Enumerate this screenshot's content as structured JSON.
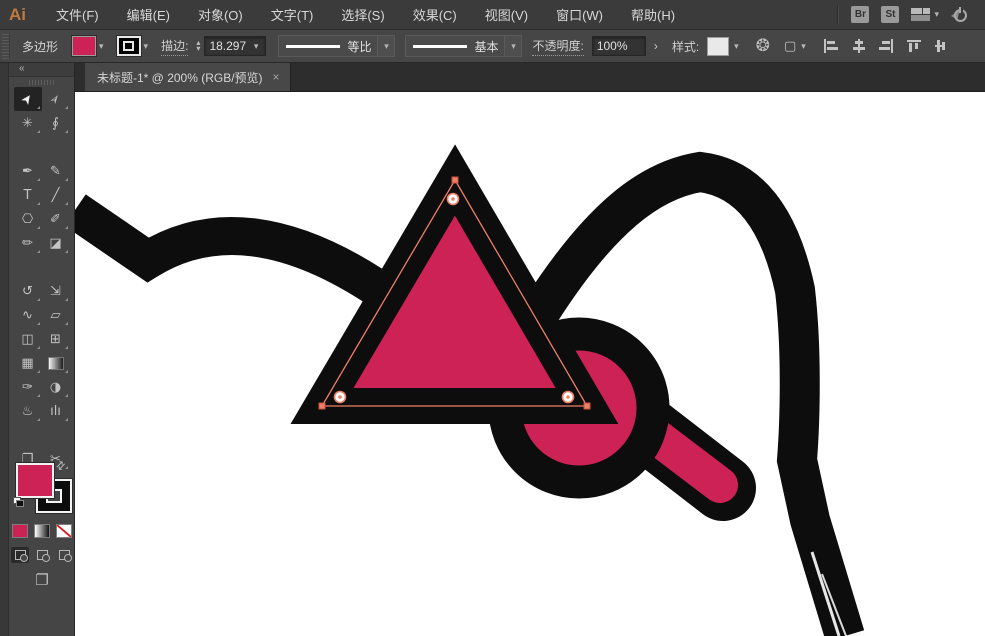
{
  "app": {
    "logo": "Ai"
  },
  "menu_bar": {
    "items": [
      {
        "name": "menu-file",
        "label": "文件(F)"
      },
      {
        "name": "menu-edit",
        "label": "编辑(E)"
      },
      {
        "name": "menu-object",
        "label": "对象(O)"
      },
      {
        "name": "menu-type",
        "label": "文字(T)"
      },
      {
        "name": "menu-select",
        "label": "选择(S)"
      },
      {
        "name": "menu-effect",
        "label": "效果(C)"
      },
      {
        "name": "menu-view",
        "label": "视图(V)"
      },
      {
        "name": "menu-window",
        "label": "窗口(W)"
      },
      {
        "name": "menu-help",
        "label": "帮助(H)"
      }
    ],
    "badges": [
      {
        "name": "bridge-badge",
        "label": "Br"
      },
      {
        "name": "stock-badge",
        "label": "St"
      }
    ]
  },
  "control_bar": {
    "context_label": "多边形",
    "stroke_label": "描边:",
    "stroke_weight": "18.297",
    "profile_label": "等比",
    "brush_label": "基本",
    "opacity_label": "不透明度:",
    "opacity_value": "100%",
    "style_label": "样式:"
  },
  "document_tab": {
    "title": "未标题-1* @ 200% (RGB/预览)",
    "close_glyph": "×"
  },
  "icons": {
    "chevron_down": "▾",
    "stepper_up": "▴",
    "stepper_down": "▾",
    "expand_arrow": "›",
    "collapse": "«",
    "swap": "⇄",
    "recolor_wheel": "❂",
    "transform_box": "▢",
    "screen_mode": "❐"
  },
  "toolbar": {
    "tools": [
      {
        "name": "selection-tool",
        "glyph": "➤",
        "cls": "rot-nw",
        "active": true
      },
      {
        "name": "direct-selection-tool",
        "glyph": "➢",
        "cls": "rot-nw"
      },
      {
        "name": "magic-wand-tool",
        "glyph": "✳"
      },
      {
        "name": "lasso-tool",
        "glyph": "∮",
        "gap": true
      },
      {
        "name": "pen-tool",
        "glyph": "✒"
      },
      {
        "name": "curvature-tool",
        "glyph": "✎"
      },
      {
        "name": "type-tool",
        "glyph": "T"
      },
      {
        "name": "line-segment-tool",
        "glyph": "╱"
      },
      {
        "name": "polygon-tool",
        "glyph": "⎔"
      },
      {
        "name": "paintbrush-tool",
        "glyph": "✐"
      },
      {
        "name": "pencil-tool",
        "glyph": "✏"
      },
      {
        "name": "eraser-tool",
        "glyph": "◪",
        "gap": true
      },
      {
        "name": "rotate-tool",
        "glyph": "↺"
      },
      {
        "name": "scale-tool",
        "glyph": "⇲"
      },
      {
        "name": "width-tool",
        "glyph": "∿"
      },
      {
        "name": "free-transform-tool",
        "glyph": "▱"
      },
      {
        "name": "shape-builder-tool",
        "glyph": "◫"
      },
      {
        "name": "perspective-grid-tool",
        "glyph": "⊞"
      },
      {
        "name": "mesh-tool",
        "glyph": "▦"
      },
      {
        "name": "gradient-tool",
        "glyph": "",
        "cls": "gradient-chip"
      },
      {
        "name": "eyedropper-tool",
        "glyph": "✑"
      },
      {
        "name": "blend-tool",
        "glyph": "◑"
      },
      {
        "name": "symbol-sprayer-tool",
        "glyph": "♨"
      },
      {
        "name": "column-graph-tool",
        "glyph": "ılı",
        "gap": true
      },
      {
        "name": "artboard-tool",
        "glyph": "❐"
      },
      {
        "name": "slice-tool",
        "glyph": "✂"
      },
      {
        "name": "hand-tool",
        "glyph": "✋"
      },
      {
        "name": "zoom-tool",
        "glyph": "⌕"
      }
    ]
  },
  "canvas": {
    "colors": {
      "pink": "#CC2255",
      "ink": "#0E0D0D",
      "selection": "#EE7E67",
      "white": "#FFFFFF"
    },
    "zoom_percent": "200%"
  }
}
